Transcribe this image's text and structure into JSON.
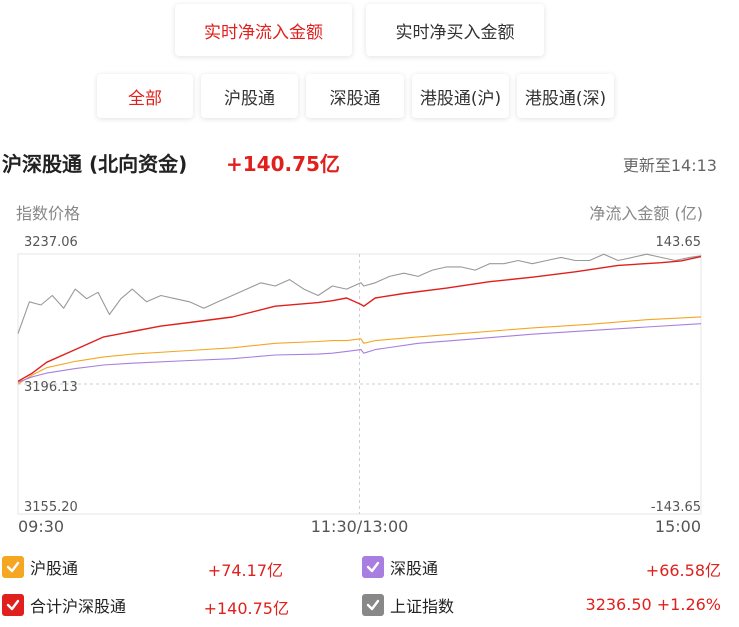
{
  "tabs": [
    {
      "label": "实时净流入金额",
      "active": true
    },
    {
      "label": "实时净买入金额",
      "active": false
    }
  ],
  "segments": [
    {
      "label": "全部",
      "active": true
    },
    {
      "label": "沪股通",
      "active": false
    },
    {
      "label": "深股通",
      "active": false
    },
    {
      "label": "港股通(沪)",
      "active": false
    },
    {
      "label": "港股通(深)",
      "active": false
    }
  ],
  "header": {
    "title": "沪深股通 (北向资金)",
    "value": "+140.75亿",
    "updated": "更新至14:13"
  },
  "axes": {
    "left_title": "指数价格",
    "right_title": "净流入金额 (亿)"
  },
  "legend": [
    {
      "label": "沪股通",
      "value": "+74.17亿",
      "color": "#f5a623",
      "icon": "check-icon"
    },
    {
      "label": "深股通",
      "value": "+66.58亿",
      "color": "#a87ee0",
      "icon": "check-icon"
    },
    {
      "label": "合计沪深股通",
      "value": "+140.75亿",
      "color": "#e0201c",
      "icon": "check-icon"
    },
    {
      "label": "上证指数",
      "value": "3236.50 +1.26%",
      "color": "#888888",
      "icon": "check-icon"
    }
  ],
  "chart_data": {
    "type": "line",
    "x_ticks": [
      "09:30",
      "11:30/13:00",
      "15:00"
    ],
    "left_ticks": [
      "3237.06",
      "3196.13",
      "3155.20"
    ],
    "right_ticks": [
      "143.65",
      "-143.65"
    ],
    "ylim_left": [
      3155.2,
      3237.06
    ],
    "ylim_right": [
      -143.65,
      143.65
    ],
    "n_sessions_points": 240,
    "grid": true,
    "series": [
      {
        "name": "合计沪深股通",
        "axis": "right",
        "color": "#e0201c",
        "x": [
          0,
          5,
          10,
          20,
          30,
          40,
          50,
          60,
          75,
          90,
          105,
          110,
          115,
          120,
          121,
          125,
          135,
          150,
          165,
          180,
          195,
          210,
          225,
          232,
          235,
          239
        ],
        "y": [
          3,
          12,
          24,
          38,
          52,
          58,
          64,
          68,
          74,
          86,
          90,
          92,
          95,
          88,
          86,
          95,
          100,
          106,
          113,
          118,
          124,
          131,
          134,
          136,
          138,
          140.75
        ]
      },
      {
        "name": "沪股通",
        "axis": "right",
        "color": "#f5a623",
        "x": [
          0,
          5,
          10,
          20,
          30,
          40,
          60,
          75,
          90,
          105,
          110,
          115,
          120,
          121,
          125,
          140,
          160,
          180,
          200,
          220,
          239
        ],
        "y": [
          0,
          10,
          18,
          25,
          30,
          33,
          37,
          40,
          45,
          47,
          48,
          48,
          50,
          45,
          48,
          52,
          57,
          62,
          66,
          71,
          74.17
        ]
      },
      {
        "name": "深股通",
        "axis": "right",
        "color": "#a87ee0",
        "x": [
          0,
          5,
          10,
          20,
          30,
          40,
          60,
          75,
          90,
          105,
          110,
          115,
          120,
          121,
          125,
          140,
          160,
          180,
          200,
          220,
          239
        ],
        "y": [
          2,
          8,
          12,
          17,
          21,
          23,
          26,
          28,
          32,
          33,
          34,
          36,
          38,
          34,
          38,
          45,
          50,
          55,
          59,
          63,
          66.58
        ]
      },
      {
        "name": "上证指数",
        "axis": "left",
        "color": "#999999",
        "x": [
          0,
          4,
          8,
          12,
          16,
          20,
          24,
          28,
          32,
          36,
          40,
          45,
          50,
          55,
          60,
          65,
          70,
          75,
          80,
          85,
          90,
          95,
          100,
          105,
          110,
          115,
          120,
          121,
          125,
          130,
          135,
          140,
          145,
          150,
          155,
          160,
          165,
          170,
          175,
          180,
          185,
          190,
          195,
          200,
          205,
          210,
          215,
          220,
          225,
          230,
          235,
          239
        ],
        "y": [
          3212,
          3222,
          3221,
          3224,
          3220,
          3226,
          3223,
          3225,
          3218,
          3223,
          3226,
          3222,
          3224,
          3223,
          3222,
          3220,
          3222,
          3224,
          3226,
          3228,
          3227,
          3229,
          3226,
          3224,
          3227,
          3226,
          3228,
          3227,
          3228,
          3230,
          3231,
          3230,
          3232,
          3233,
          3233,
          3232,
          3234,
          3234,
          3235,
          3234,
          3235,
          3236,
          3235,
          3235,
          3237,
          3235,
          3236,
          3237,
          3236,
          3235,
          3236,
          3236.5
        ]
      }
    ]
  }
}
